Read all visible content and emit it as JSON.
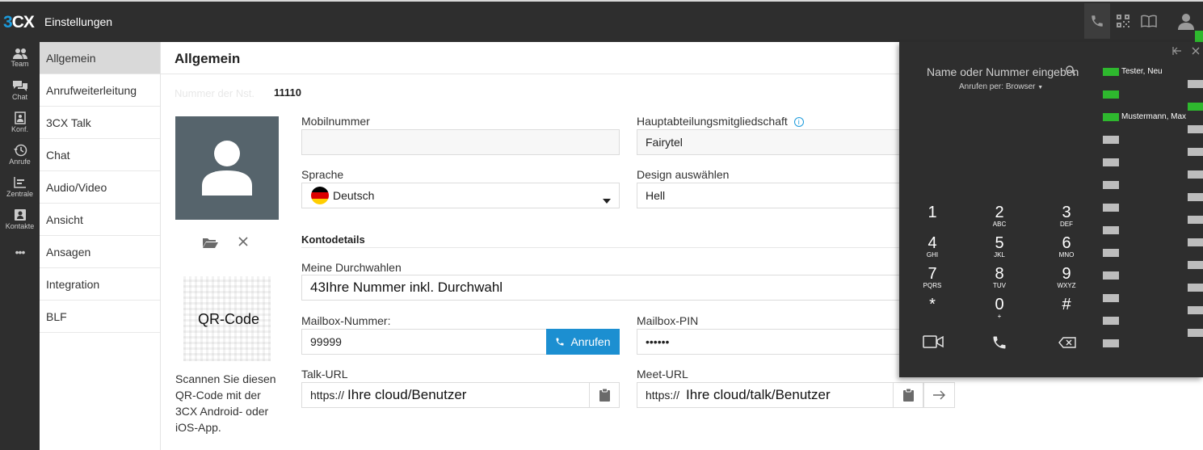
{
  "app": {
    "logo_a": "3",
    "logo_b": "CX",
    "title": "Einstellungen"
  },
  "topbar": {
    "icons": [
      "phone-icon",
      "qr-code-icon",
      "phonebook-icon",
      "user-icon"
    ],
    "status_color": "#2eb82e"
  },
  "leftnav": [
    {
      "label": "Team",
      "icon": "team-icon"
    },
    {
      "label": "Chat",
      "icon": "chat-icon"
    },
    {
      "label": "Konf.",
      "icon": "conference-icon"
    },
    {
      "label": "Anrufe",
      "icon": "history-icon"
    },
    {
      "label": "Zentrale",
      "icon": "switchboard-icon"
    },
    {
      "label": "Kontakte",
      "icon": "contacts-icon"
    },
    {
      "label": "•••",
      "icon": "more-icon"
    }
  ],
  "submenu": [
    "Allgemein",
    "Anrufweiterleitung",
    "3CX Talk",
    "Chat",
    "Audio/Video",
    "Ansicht",
    "Ansagen",
    "Integration",
    "BLF"
  ],
  "main": {
    "title": "Allgemein",
    "extension_label": "Nummer der Nst.",
    "extension_value": "11110",
    "qr_label": "QR-Code",
    "qr_desc": "Scannen Sie diesen QR-Code mit der 3CX Android- oder iOS-App.",
    "mobile_label": "Mobilnummer",
    "mobile_value": "",
    "dept_label": "Hauptabteilungsmitgliedschaft",
    "dept_value": "Fairytel",
    "language_label": "Sprache",
    "language_value": "Deutsch",
    "design_label": "Design auswählen",
    "design_value": "Hell",
    "account_heading": "Kontodetails",
    "dids_label": "Meine Durchwahlen",
    "dids_value": "43Ihre Nummer inkl. Durchwahl",
    "mailbox_label": "Mailbox-Nummer:",
    "mailbox_value": "99999",
    "call_button": "Anrufen",
    "pin_label": "Mailbox-PIN",
    "pin_value": "••••••",
    "talk_label": "Talk-URL",
    "talk_prefix": "https://",
    "talk_value": "Ihre cloud/Benutzer",
    "meet_label": "Meet-URL",
    "meet_prefix": "https://",
    "meet_value": "Ihre cloud/talk/Benutzer"
  },
  "dialer": {
    "search_placeholder": "Name oder Nummer eingeben",
    "call_via": "Anrufen per: Browser",
    "keys": [
      {
        "d": "1",
        "s": ""
      },
      {
        "d": "2",
        "s": "ABC"
      },
      {
        "d": "3",
        "s": "DEF"
      },
      {
        "d": "4",
        "s": "GHI"
      },
      {
        "d": "5",
        "s": "JKL"
      },
      {
        "d": "6",
        "s": "MNO"
      },
      {
        "d": "7",
        "s": "PQRS"
      },
      {
        "d": "8",
        "s": "TUV"
      },
      {
        "d": "9",
        "s": "WXYZ"
      },
      {
        "d": "*",
        "s": ""
      },
      {
        "d": "0",
        "s": "+"
      },
      {
        "d": "#",
        "s": ""
      }
    ],
    "blf": [
      {
        "name": "Tester, Neu",
        "status": "green"
      },
      {
        "name": "",
        "status": "green"
      },
      {
        "name": "Mustermann, Max",
        "status": "green"
      }
    ]
  }
}
